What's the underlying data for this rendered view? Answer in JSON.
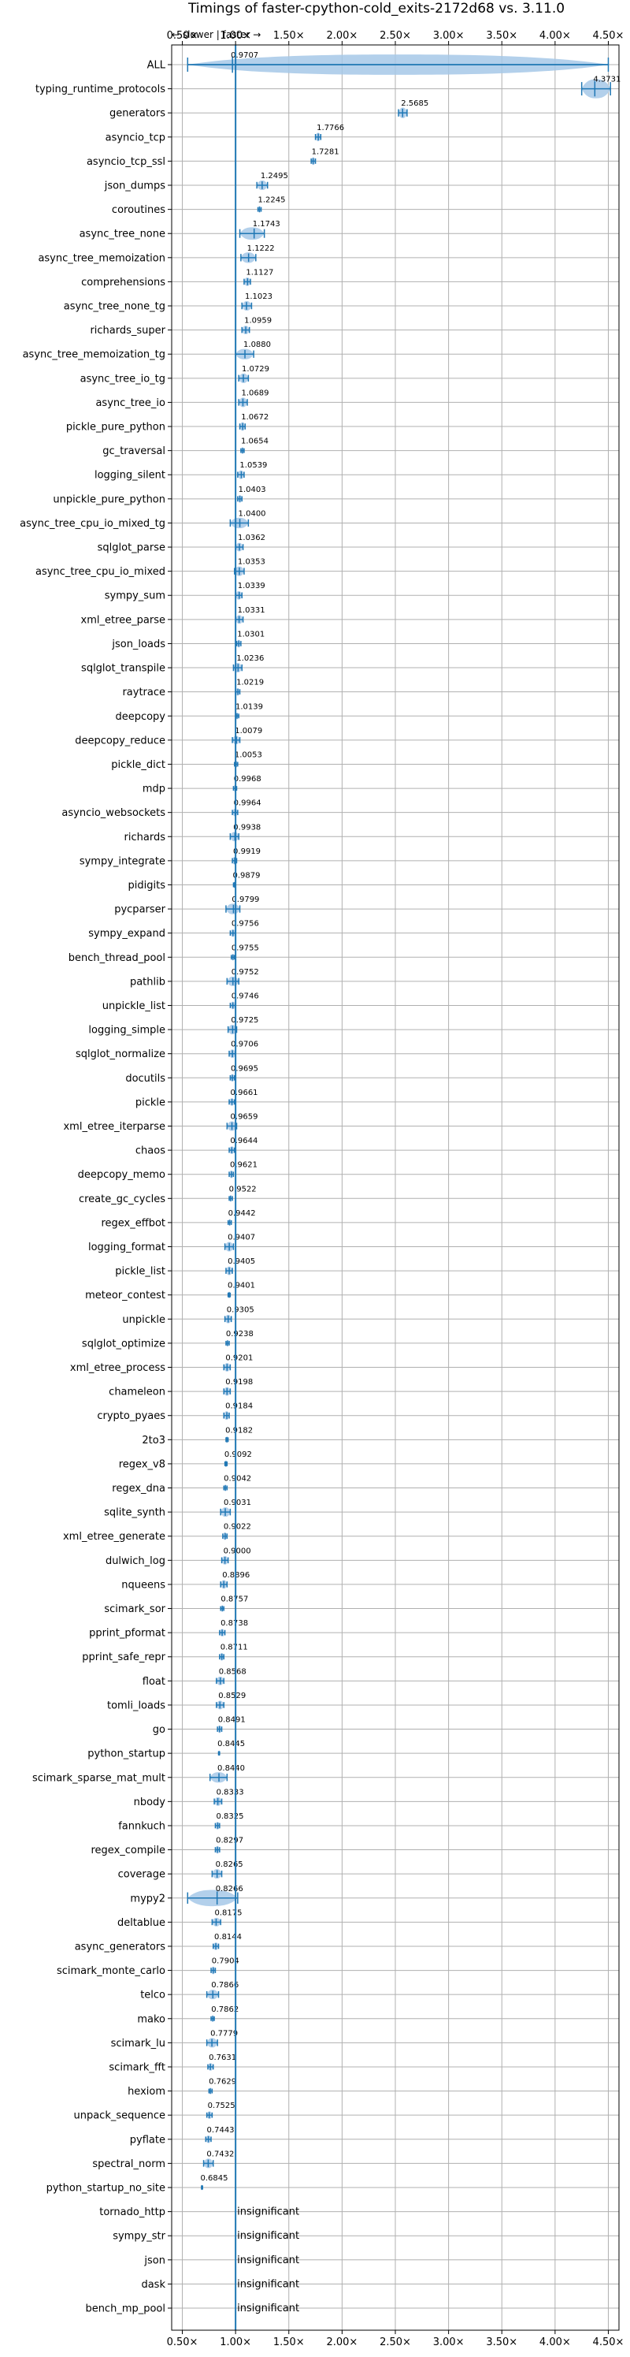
{
  "chart_data": {
    "type": "violin",
    "title": "Timings of faster-cpython-cold_exits-2172d68 vs. 3.11.0",
    "direction_hint": "← slower | faster →",
    "xlim": [
      0.4,
      4.6
    ],
    "xticks": [
      "0.50×",
      "1.00×",
      "1.50×",
      "2.00×",
      "2.50×",
      "3.00×",
      "3.50×",
      "4.00×",
      "4.50×"
    ],
    "xtick_values": [
      0.5,
      1.0,
      1.5,
      2.0,
      2.5,
      3.0,
      3.5,
      4.0,
      4.5
    ],
    "reference_line": 1.0,
    "grid": true,
    "insignificant_label": "insignificant",
    "colors": {
      "violin": "#a6c8e8",
      "line": "#1f77b4",
      "grid": "#b0b0b0"
    },
    "categories": [
      {
        "name": "ALL",
        "value": 0.9707,
        "label": "0.9707",
        "lo": 0.55,
        "hi": 4.5,
        "width": 0.25
      },
      {
        "name": "typing_runtime_protocols",
        "value": 4.3731,
        "label": "4.3731",
        "lo": 4.25,
        "hi": 4.52,
        "width": 0.15
      },
      {
        "name": "generators",
        "value": 2.5685,
        "label": "2.5685",
        "lo": 2.53,
        "hi": 2.61,
        "width": 0.06
      },
      {
        "name": "asyncio_tcp",
        "value": 1.7766,
        "label": "1.7766",
        "lo": 1.75,
        "hi": 1.8,
        "width": 0.04
      },
      {
        "name": "asyncio_tcp_ssl",
        "value": 1.7281,
        "label": "1.7281",
        "lo": 1.71,
        "hi": 1.75,
        "width": 0.03
      },
      {
        "name": "json_dumps",
        "value": 1.2495,
        "label": "1.2495",
        "lo": 1.2,
        "hi": 1.3,
        "width": 0.05
      },
      {
        "name": "coroutines",
        "value": 1.2245,
        "label": "1.2245",
        "lo": 1.21,
        "hi": 1.24,
        "width": 0.02
      },
      {
        "name": "async_tree_none",
        "value": 1.1743,
        "label": "1.1743",
        "lo": 1.04,
        "hi": 1.27,
        "width": 0.08
      },
      {
        "name": "async_tree_memoization",
        "value": 1.1222,
        "label": "1.1222",
        "lo": 1.05,
        "hi": 1.19,
        "width": 0.06
      },
      {
        "name": "comprehensions",
        "value": 1.1127,
        "label": "1.1127",
        "lo": 1.08,
        "hi": 1.14,
        "width": 0.04
      },
      {
        "name": "async_tree_none_tg",
        "value": 1.1023,
        "label": "1.1023",
        "lo": 1.06,
        "hi": 1.15,
        "width": 0.05
      },
      {
        "name": "richards_super",
        "value": 1.0959,
        "label": "1.0959",
        "lo": 1.06,
        "hi": 1.13,
        "width": 0.04
      },
      {
        "name": "async_tree_memoization_tg",
        "value": 1.088,
        "label": "1.0880",
        "lo": 1.0,
        "hi": 1.17,
        "width": 0.06
      },
      {
        "name": "async_tree_io_tg",
        "value": 1.0729,
        "label": "1.0729",
        "lo": 1.03,
        "hi": 1.12,
        "width": 0.05
      },
      {
        "name": "async_tree_io",
        "value": 1.0689,
        "label": "1.0689",
        "lo": 1.03,
        "hi": 1.11,
        "width": 0.05
      },
      {
        "name": "pickle_pure_python",
        "value": 1.0672,
        "label": "1.0672",
        "lo": 1.04,
        "hi": 1.09,
        "width": 0.04
      },
      {
        "name": "gc_traversal",
        "value": 1.0654,
        "label": "1.0654",
        "lo": 1.05,
        "hi": 1.08,
        "width": 0.02
      },
      {
        "name": "logging_silent",
        "value": 1.0539,
        "label": "1.0539",
        "lo": 1.02,
        "hi": 1.08,
        "width": 0.04
      },
      {
        "name": "unpickle_pure_python",
        "value": 1.0403,
        "label": "1.0403",
        "lo": 1.02,
        "hi": 1.06,
        "width": 0.03
      },
      {
        "name": "async_tree_cpu_io_mixed_tg",
        "value": 1.04,
        "label": "1.0400",
        "lo": 0.95,
        "hi": 1.12,
        "width": 0.06
      },
      {
        "name": "sqlglot_parse",
        "value": 1.0362,
        "label": "1.0362",
        "lo": 1.0,
        "hi": 1.07,
        "width": 0.04
      },
      {
        "name": "async_tree_cpu_io_mixed",
        "value": 1.0353,
        "label": "1.0353",
        "lo": 0.99,
        "hi": 1.08,
        "width": 0.05
      },
      {
        "name": "sympy_sum",
        "value": 1.0339,
        "label": "1.0339",
        "lo": 1.0,
        "hi": 1.06,
        "width": 0.04
      },
      {
        "name": "xml_etree_parse",
        "value": 1.0331,
        "label": "1.0331",
        "lo": 1.0,
        "hi": 1.07,
        "width": 0.04
      },
      {
        "name": "json_loads",
        "value": 1.0301,
        "label": "1.0301",
        "lo": 1.01,
        "hi": 1.05,
        "width": 0.03
      },
      {
        "name": "sqlglot_transpile",
        "value": 1.0236,
        "label": "1.0236",
        "lo": 0.98,
        "hi": 1.06,
        "width": 0.05
      },
      {
        "name": "raytrace",
        "value": 1.0219,
        "label": "1.0219",
        "lo": 1.0,
        "hi": 1.04,
        "width": 0.03
      },
      {
        "name": "deepcopy",
        "value": 1.0139,
        "label": "1.0139",
        "lo": 1.0,
        "hi": 1.03,
        "width": 0.02
      },
      {
        "name": "deepcopy_reduce",
        "value": 1.0079,
        "label": "1.0079",
        "lo": 0.97,
        "hi": 1.04,
        "width": 0.04
      },
      {
        "name": "pickle_dict",
        "value": 1.0053,
        "label": "1.0053",
        "lo": 0.99,
        "hi": 1.02,
        "width": 0.02
      },
      {
        "name": "mdp",
        "value": 0.9968,
        "label": "0.9968",
        "lo": 0.98,
        "hi": 1.01,
        "width": 0.02
      },
      {
        "name": "asyncio_websockets",
        "value": 0.9964,
        "label": "0.9964",
        "lo": 0.97,
        "hi": 1.02,
        "width": 0.03
      },
      {
        "name": "richards",
        "value": 0.9938,
        "label": "0.9938",
        "lo": 0.95,
        "hi": 1.03,
        "width": 0.05
      },
      {
        "name": "sympy_integrate",
        "value": 0.9919,
        "label": "0.9919",
        "lo": 0.97,
        "hi": 1.01,
        "width": 0.03
      },
      {
        "name": "pidigits",
        "value": 0.9879,
        "label": "0.9879",
        "lo": 0.98,
        "hi": 1.0,
        "width": 0.02
      },
      {
        "name": "pycparser",
        "value": 0.9799,
        "label": "0.9799",
        "lo": 0.91,
        "hi": 1.04,
        "width": 0.06
      },
      {
        "name": "sympy_expand",
        "value": 0.9756,
        "label": "0.9756",
        "lo": 0.95,
        "hi": 1.0,
        "width": 0.03
      },
      {
        "name": "bench_thread_pool",
        "value": 0.9755,
        "label": "0.9755",
        "lo": 0.96,
        "hi": 0.99,
        "width": 0.02
      },
      {
        "name": "pathlib",
        "value": 0.9752,
        "label": "0.9752",
        "lo": 0.92,
        "hi": 1.03,
        "width": 0.05
      },
      {
        "name": "unpickle_list",
        "value": 0.9746,
        "label": "0.9746",
        "lo": 0.95,
        "hi": 1.0,
        "width": 0.03
      },
      {
        "name": "logging_simple",
        "value": 0.9725,
        "label": "0.9725",
        "lo": 0.93,
        "hi": 1.01,
        "width": 0.05
      },
      {
        "name": "sqlglot_normalize",
        "value": 0.9706,
        "label": "0.9706",
        "lo": 0.94,
        "hi": 1.0,
        "width": 0.04
      },
      {
        "name": "docutils",
        "value": 0.9695,
        "label": "0.9695",
        "lo": 0.95,
        "hi": 0.99,
        "width": 0.03
      },
      {
        "name": "pickle",
        "value": 0.9661,
        "label": "0.9661",
        "lo": 0.94,
        "hi": 0.99,
        "width": 0.03
      },
      {
        "name": "xml_etree_iterparse",
        "value": 0.9659,
        "label": "0.9659",
        "lo": 0.92,
        "hi": 1.01,
        "width": 0.05
      },
      {
        "name": "chaos",
        "value": 0.9644,
        "label": "0.9644",
        "lo": 0.94,
        "hi": 0.99,
        "width": 0.03
      },
      {
        "name": "deepcopy_memo",
        "value": 0.9621,
        "label": "0.9621",
        "lo": 0.94,
        "hi": 0.98,
        "width": 0.03
      },
      {
        "name": "create_gc_cycles",
        "value": 0.9522,
        "label": "0.9522",
        "lo": 0.94,
        "hi": 0.97,
        "width": 0.02
      },
      {
        "name": "regex_effbot",
        "value": 0.9442,
        "label": "0.9442",
        "lo": 0.93,
        "hi": 0.96,
        "width": 0.02
      },
      {
        "name": "logging_format",
        "value": 0.9407,
        "label": "0.9407",
        "lo": 0.9,
        "hi": 0.98,
        "width": 0.05
      },
      {
        "name": "pickle_list",
        "value": 0.9405,
        "label": "0.9405",
        "lo": 0.91,
        "hi": 0.97,
        "width": 0.04
      },
      {
        "name": "meteor_contest",
        "value": 0.9401,
        "label": "0.9401",
        "lo": 0.93,
        "hi": 0.95,
        "width": 0.02
      },
      {
        "name": "unpickle",
        "value": 0.9305,
        "label": "0.9305",
        "lo": 0.9,
        "hi": 0.96,
        "width": 0.04
      },
      {
        "name": "sqlglot_optimize",
        "value": 0.9238,
        "label": "0.9238",
        "lo": 0.91,
        "hi": 0.94,
        "width": 0.02
      },
      {
        "name": "xml_etree_process",
        "value": 0.9201,
        "label": "0.9201",
        "lo": 0.89,
        "hi": 0.95,
        "width": 0.04
      },
      {
        "name": "chameleon",
        "value": 0.9198,
        "label": "0.9198",
        "lo": 0.89,
        "hi": 0.95,
        "width": 0.04
      },
      {
        "name": "crypto_pyaes",
        "value": 0.9184,
        "label": "0.9184",
        "lo": 0.89,
        "hi": 0.94,
        "width": 0.04
      },
      {
        "name": "2to3",
        "value": 0.9182,
        "label": "0.9182",
        "lo": 0.91,
        "hi": 0.93,
        "width": 0.02
      },
      {
        "name": "regex_v8",
        "value": 0.9092,
        "label": "0.9092",
        "lo": 0.9,
        "hi": 0.92,
        "width": 0.02
      },
      {
        "name": "regex_dna",
        "value": 0.9042,
        "label": "0.9042",
        "lo": 0.89,
        "hi": 0.92,
        "width": 0.02
      },
      {
        "name": "sqlite_synth",
        "value": 0.9031,
        "label": "0.9031",
        "lo": 0.86,
        "hi": 0.95,
        "width": 0.05
      },
      {
        "name": "xml_etree_generate",
        "value": 0.9022,
        "label": "0.9022",
        "lo": 0.88,
        "hi": 0.92,
        "width": 0.03
      },
      {
        "name": "dulwich_log",
        "value": 0.9,
        "label": "0.9000",
        "lo": 0.87,
        "hi": 0.93,
        "width": 0.04
      },
      {
        "name": "nqueens",
        "value": 0.8896,
        "label": "0.8896",
        "lo": 0.86,
        "hi": 0.92,
        "width": 0.04
      },
      {
        "name": "scimark_sor",
        "value": 0.8757,
        "label": "0.8757",
        "lo": 0.86,
        "hi": 0.89,
        "width": 0.02
      },
      {
        "name": "pprint_pformat",
        "value": 0.8738,
        "label": "0.8738",
        "lo": 0.85,
        "hi": 0.9,
        "width": 0.03
      },
      {
        "name": "pprint_safe_repr",
        "value": 0.8711,
        "label": "0.8711",
        "lo": 0.85,
        "hi": 0.89,
        "width": 0.03
      },
      {
        "name": "float",
        "value": 0.8568,
        "label": "0.8568",
        "lo": 0.82,
        "hi": 0.89,
        "width": 0.04
      },
      {
        "name": "tomli_loads",
        "value": 0.8529,
        "label": "0.8529",
        "lo": 0.82,
        "hi": 0.89,
        "width": 0.04
      },
      {
        "name": "go",
        "value": 0.8491,
        "label": "0.8491",
        "lo": 0.83,
        "hi": 0.87,
        "width": 0.03
      },
      {
        "name": "python_startup",
        "value": 0.8445,
        "label": "0.8445",
        "lo": 0.84,
        "hi": 0.85,
        "width": 0.01
      },
      {
        "name": "scimark_sparse_mat_mult",
        "value": 0.844,
        "label": "0.8440",
        "lo": 0.76,
        "hi": 0.92,
        "width": 0.06
      },
      {
        "name": "nbody",
        "value": 0.8333,
        "label": "0.8333",
        "lo": 0.8,
        "hi": 0.87,
        "width": 0.04
      },
      {
        "name": "fannkuch",
        "value": 0.8325,
        "label": "0.8325",
        "lo": 0.81,
        "hi": 0.85,
        "width": 0.03
      },
      {
        "name": "regex_compile",
        "value": 0.8297,
        "label": "0.8297",
        "lo": 0.81,
        "hi": 0.85,
        "width": 0.03
      },
      {
        "name": "coverage",
        "value": 0.8265,
        "label": "0.8265",
        "lo": 0.78,
        "hi": 0.87,
        "width": 0.05
      },
      {
        "name": "mypy2",
        "value": 0.8266,
        "label": "0.8266",
        "lo": 0.55,
        "hi": 1.02,
        "width": 0.12
      },
      {
        "name": "deltablue",
        "value": 0.8175,
        "label": "0.8175",
        "lo": 0.78,
        "hi": 0.86,
        "width": 0.04
      },
      {
        "name": "async_generators",
        "value": 0.8144,
        "label": "0.8144",
        "lo": 0.79,
        "hi": 0.84,
        "width": 0.03
      },
      {
        "name": "scimark_monte_carlo",
        "value": 0.7904,
        "label": "0.7904",
        "lo": 0.77,
        "hi": 0.81,
        "width": 0.03
      },
      {
        "name": "telco",
        "value": 0.7866,
        "label": "0.7866",
        "lo": 0.73,
        "hi": 0.84,
        "width": 0.05
      },
      {
        "name": "mako",
        "value": 0.7862,
        "label": "0.7862",
        "lo": 0.77,
        "hi": 0.8,
        "width": 0.02
      },
      {
        "name": "scimark_lu",
        "value": 0.7779,
        "label": "0.7779",
        "lo": 0.73,
        "hi": 0.83,
        "width": 0.05
      },
      {
        "name": "scimark_fft",
        "value": 0.7631,
        "label": "0.7631",
        "lo": 0.74,
        "hi": 0.79,
        "width": 0.03
      },
      {
        "name": "hexiom",
        "value": 0.7629,
        "label": "0.7629",
        "lo": 0.75,
        "hi": 0.78,
        "width": 0.02
      },
      {
        "name": "unpack_sequence",
        "value": 0.7525,
        "label": "0.7525",
        "lo": 0.73,
        "hi": 0.78,
        "width": 0.03
      },
      {
        "name": "pyflate",
        "value": 0.7443,
        "label": "0.7443",
        "lo": 0.72,
        "hi": 0.77,
        "width": 0.03
      },
      {
        "name": "spectral_norm",
        "value": 0.7432,
        "label": "0.7432",
        "lo": 0.7,
        "hi": 0.79,
        "width": 0.05
      },
      {
        "name": "python_startup_no_site",
        "value": 0.6845,
        "label": "0.6845",
        "lo": 0.68,
        "hi": 0.69,
        "width": 0.01
      },
      {
        "name": "tornado_http",
        "value": null,
        "label": "insignificant"
      },
      {
        "name": "sympy_str",
        "value": null,
        "label": "insignificant"
      },
      {
        "name": "json",
        "value": null,
        "label": "insignificant"
      },
      {
        "name": "dask",
        "value": null,
        "label": "insignificant"
      },
      {
        "name": "bench_mp_pool",
        "value": null,
        "label": "insignificant"
      }
    ]
  }
}
